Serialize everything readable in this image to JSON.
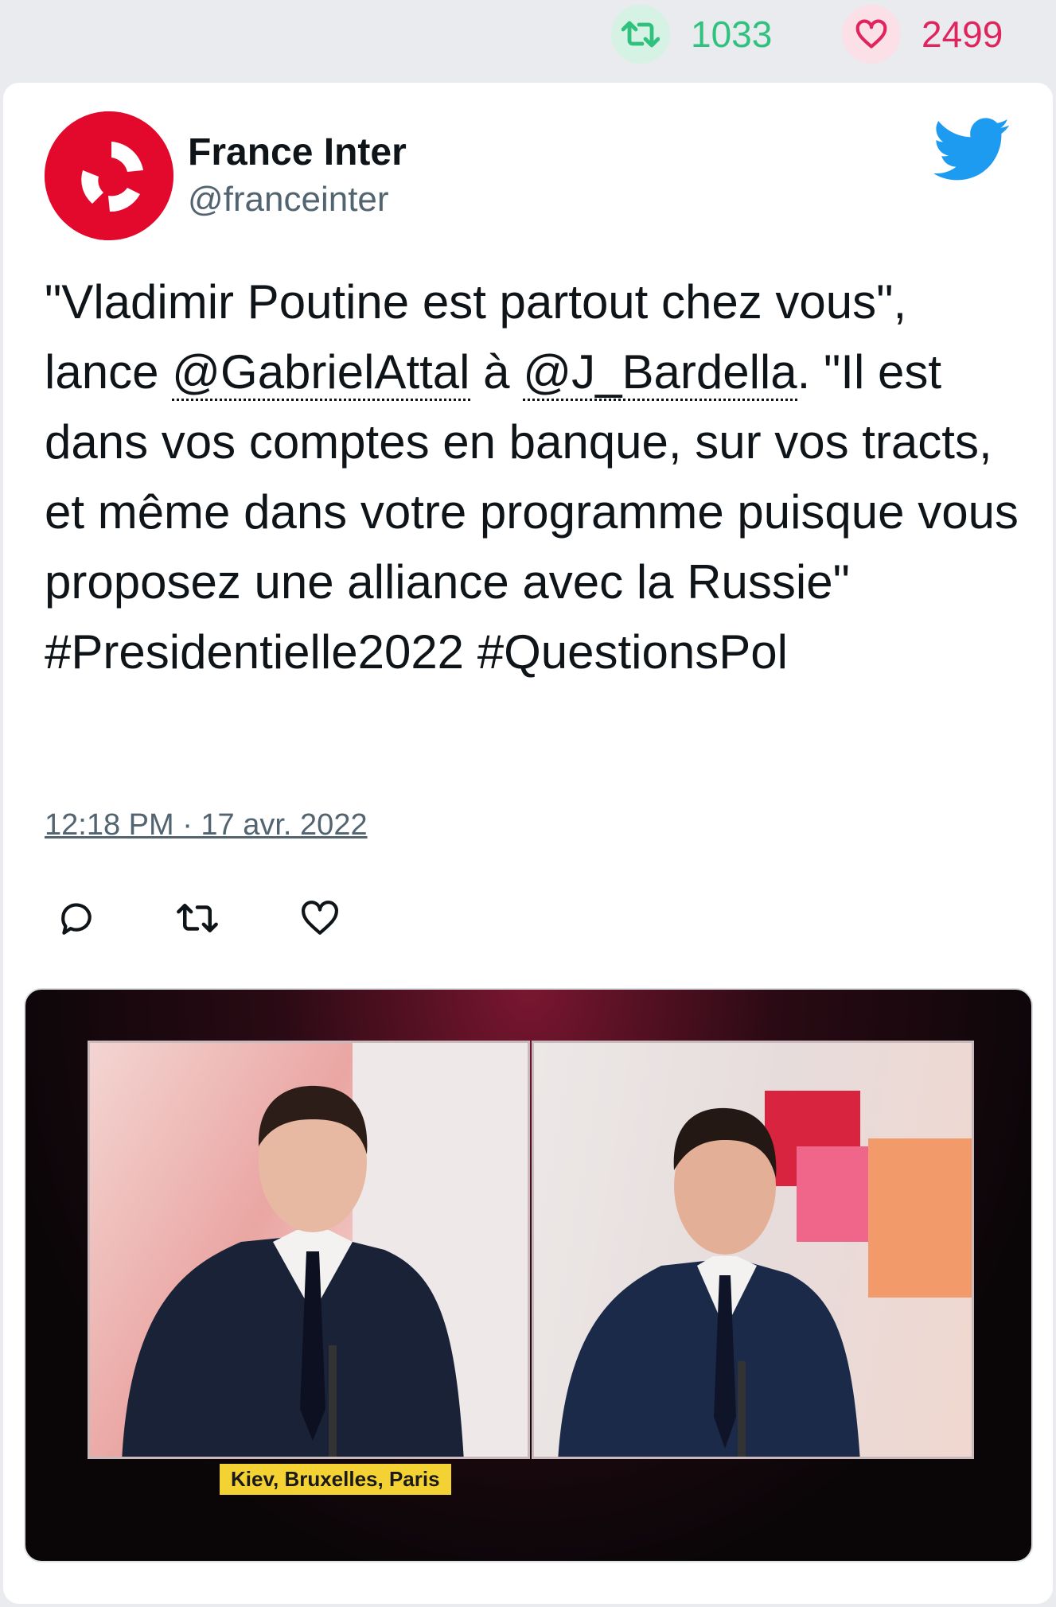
{
  "stats": {
    "retweets": "1033",
    "likes": "2499"
  },
  "tweet": {
    "display_name": "France Inter",
    "handle": "@franceinter",
    "text_parts": {
      "p1": "\"Vladimir Poutine est partout chez vous\", lance ",
      "mention1": "@GabrielAttal",
      "p2": " à ",
      "mention2": "@J_Bardella",
      "p3": ". \"Il est dans vos comptes en banque, sur vos tracts, et même dans votre programme puisque vous proposez une alliance avec la Russie\" ",
      "hashtag1": "#Presidentielle2022",
      "p4": " ",
      "hashtag2": "#QuestionsPol"
    },
    "timestamp": "12:18 PM · 17 avr. 2022"
  },
  "media": {
    "caption": "Kiev, Bruxelles, Paris"
  },
  "icons": {
    "retweet": "retweet-icon",
    "like": "heart-icon",
    "reply": "reply-icon",
    "brand": "twitter-bird-icon",
    "avatar": "france-inter-logo"
  },
  "colors": {
    "retweet_green": "#2ec27e",
    "like_red": "#e0245e",
    "twitter_blue": "#1d9bf0",
    "brand_red": "#e2092c"
  }
}
